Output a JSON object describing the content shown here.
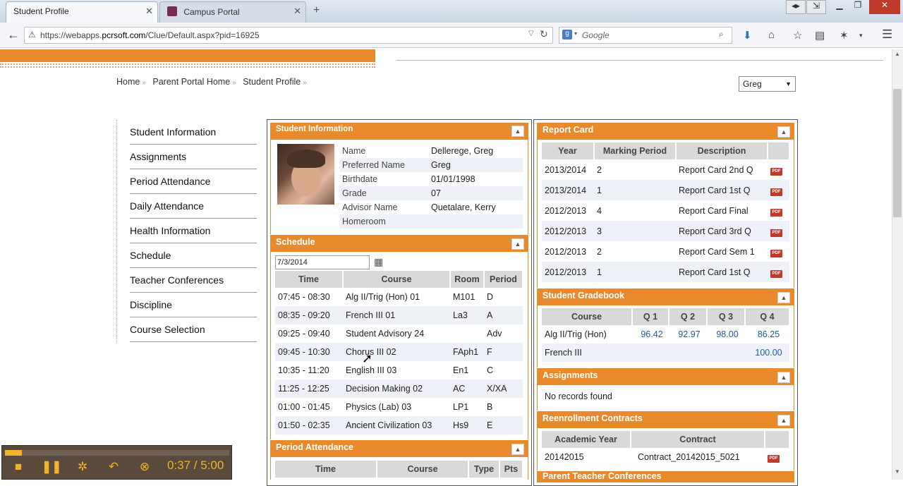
{
  "browser": {
    "tabs": [
      {
        "label": "Student Profile",
        "active": true
      },
      {
        "label": "Campus Portal",
        "active": false
      }
    ],
    "url_prefix": "https://webapps.",
    "url_domain": "pcrsoft.com",
    "url_rest": "/Clue/Default.aspx?pid=16925",
    "search_engine": "Google"
  },
  "breadcrumb": [
    "Home",
    "Parent Portal Home",
    "Student Profile"
  ],
  "student_selector": "Greg",
  "nav": [
    "Student Information",
    "Assignments",
    "Period Attendance",
    "Daily Attendance",
    "Health Information",
    "Schedule",
    "Teacher Conferences",
    "Discipline",
    "Course Selection"
  ],
  "student_info": {
    "title": "Student Information",
    "fields": [
      {
        "label": "Name",
        "value": "Dellerege, Greg"
      },
      {
        "label": "Preferred Name",
        "value": "Greg"
      },
      {
        "label": "Birthdate",
        "value": "01/01/1998"
      },
      {
        "label": "Grade",
        "value": "07"
      },
      {
        "label": "Advisor Name",
        "value": "Quetalare, Kerry"
      },
      {
        "label": "Homeroom",
        "value": ""
      }
    ]
  },
  "schedule": {
    "title": "Schedule",
    "date": "7/3/2014",
    "headers": [
      "Time",
      "Course",
      "Room",
      "Period"
    ],
    "rows": [
      [
        "07:45  - 08:30",
        "Alg II/Trig (Hon)  01",
        "M101",
        "D"
      ],
      [
        "08:35  - 09:20",
        "French III  01",
        "La3",
        "A"
      ],
      [
        "09:25  - 09:40",
        "Student Advisory  24",
        "",
        "Adv"
      ],
      [
        "09:45  - 10:30",
        "Chorus III  02",
        "FAph1",
        "F"
      ],
      [
        "10:35  - 11:20",
        "English III  03",
        "En1",
        "C"
      ],
      [
        "11:25  - 12:25",
        "Decision Making  02",
        "AC",
        "X/XA"
      ],
      [
        "01:00  - 01:45",
        "Physics (Lab)  03",
        "LP1",
        "B"
      ],
      [
        "01:50  - 02:35",
        "Ancient Civilization  03",
        "Hs9",
        "E"
      ]
    ]
  },
  "period_attendance": {
    "title": "Period Attendance",
    "headers": [
      "Time",
      "Course",
      "Type",
      "Pts"
    ]
  },
  "report_card": {
    "title": "Report Card",
    "headers": [
      "Year",
      "Marking Period",
      "Description"
    ],
    "rows": [
      [
        "2013/2014",
        "2",
        "Report Card 2nd Q"
      ],
      [
        "2013/2014",
        "1",
        "Report Card 1st Q"
      ],
      [
        "2012/2013",
        "4",
        "Report Card Final"
      ],
      [
        "2012/2013",
        "3",
        "Report Card 3rd Q"
      ],
      [
        "2012/2013",
        "2",
        "Report Card Sem 1"
      ],
      [
        "2012/2013",
        "1",
        "Report Card 1st Q"
      ]
    ]
  },
  "gradebook": {
    "title": "Student Gradebook",
    "headers": [
      "Course",
      "Q 1",
      "Q 2",
      "Q 3",
      "Q 4"
    ],
    "rows": [
      [
        "Alg II/Trig (Hon)",
        "96.42",
        "92.97",
        "98.00",
        "86.25"
      ],
      [
        "French III",
        "",
        "",
        "",
        "100.00"
      ]
    ]
  },
  "assignments": {
    "title": "Assignments",
    "empty_text": "No records found"
  },
  "reenrollment": {
    "title": "Reenrollment Contracts",
    "headers": [
      "Academic Year",
      "Contract"
    ],
    "rows": [
      [
        "20142015",
        "Contract_20142015_5021"
      ]
    ]
  },
  "parent_teacher": {
    "title": "Parent Teacher Conferences"
  },
  "player": {
    "time": "0:37 / 5:00",
    "progress": 0.074
  },
  "pdf_label": "PDF",
  "collapse_glyph": "▲"
}
